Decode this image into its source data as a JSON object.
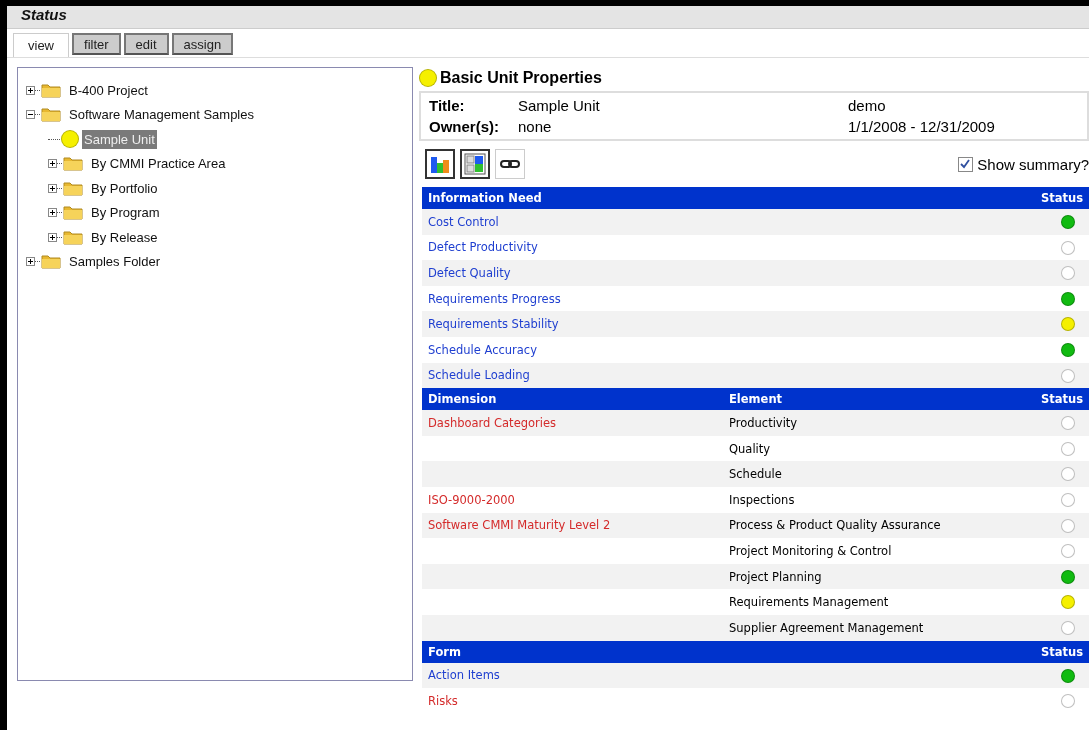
{
  "window": {
    "title": "Status"
  },
  "tabs": [
    {
      "label": "view",
      "selected": true
    },
    {
      "label": "filter",
      "selected": false
    },
    {
      "label": "edit",
      "selected": false
    },
    {
      "label": "assign",
      "selected": false
    }
  ],
  "tree": [
    {
      "label": "B-400 Project",
      "kind": "folder",
      "expanded": false,
      "selected": false
    },
    {
      "label": "Software Management Samples",
      "kind": "folder",
      "expanded": true,
      "selected": false,
      "children": [
        {
          "label": "Sample Unit",
          "kind": "unit",
          "color": "#f5f000",
          "selected": true
        },
        {
          "label": "By CMMI Practice Area",
          "kind": "folder",
          "expanded": false,
          "selected": false
        },
        {
          "label": "By Portfolio",
          "kind": "folder",
          "expanded": false,
          "selected": false
        },
        {
          "label": "By Program",
          "kind": "folder",
          "expanded": false,
          "selected": false
        },
        {
          "label": "By Release",
          "kind": "folder",
          "expanded": false,
          "selected": false
        }
      ]
    },
    {
      "label": "Samples Folder",
      "kind": "folder",
      "expanded": false,
      "selected": false
    }
  ],
  "properties": {
    "heading": "Basic Unit Properties",
    "color": "#f5f000",
    "title_label": "Title:",
    "title_value": "Sample Unit",
    "title_extra": "demo",
    "owner_label": "Owner(s):",
    "owner_value": "none",
    "owner_extra": "1/1/2008 - 12/31/2009"
  },
  "show_summary": {
    "label": "Show summary?",
    "checked": true
  },
  "information_table": {
    "columns": [
      "Information Need",
      "Status"
    ],
    "rows": [
      {
        "name": "Cost Control",
        "color": "#11bb11"
      },
      {
        "name": "Defect Productivity",
        "color": "#ffffff"
      },
      {
        "name": "Defect Quality",
        "color": "#ffffff"
      },
      {
        "name": "Requirements Progress",
        "color": "#11bb11"
      },
      {
        "name": "Requirements Stability",
        "color": "#f5f000"
      },
      {
        "name": "Schedule Accuracy",
        "color": "#11bb11"
      },
      {
        "name": "Schedule Loading",
        "color": "#ffffff"
      }
    ]
  },
  "dimension_table": {
    "columns": [
      "Dimension",
      "Element",
      "Status"
    ],
    "rows": [
      {
        "dimension": "Dashboard Categories",
        "element": "Productivity",
        "color": "#ffffff"
      },
      {
        "element": "Quality",
        "color": "#ffffff"
      },
      {
        "element": "Schedule",
        "color": "#ffffff"
      },
      {
        "dimension": "ISO-9000-2000",
        "element": "Inspections",
        "color": "#ffffff"
      },
      {
        "dimension": "Software CMMI Maturity Level 2",
        "element": "Process & Product Quality Assurance",
        "color": "#ffffff"
      },
      {
        "element": "Project Monitoring & Control",
        "color": "#ffffff"
      },
      {
        "element": "Project Planning",
        "color": "#11bb11"
      },
      {
        "element": "Requirements Management",
        "color": "#f5f000"
      },
      {
        "element": "Supplier Agreement Management",
        "color": "#ffffff"
      }
    ]
  },
  "form_table": {
    "columns": [
      "Form",
      "Status"
    ],
    "rows": [
      {
        "form": {
          "text": "Action Items",
          "color": "#1f3fd0"
        },
        "status": {
          "color": "#11bb11"
        }
      },
      {
        "form": {
          "text": "Risks",
          "color": "#d42a2a"
        },
        "status": {
          "color": "#ffffff"
        }
      }
    ]
  }
}
